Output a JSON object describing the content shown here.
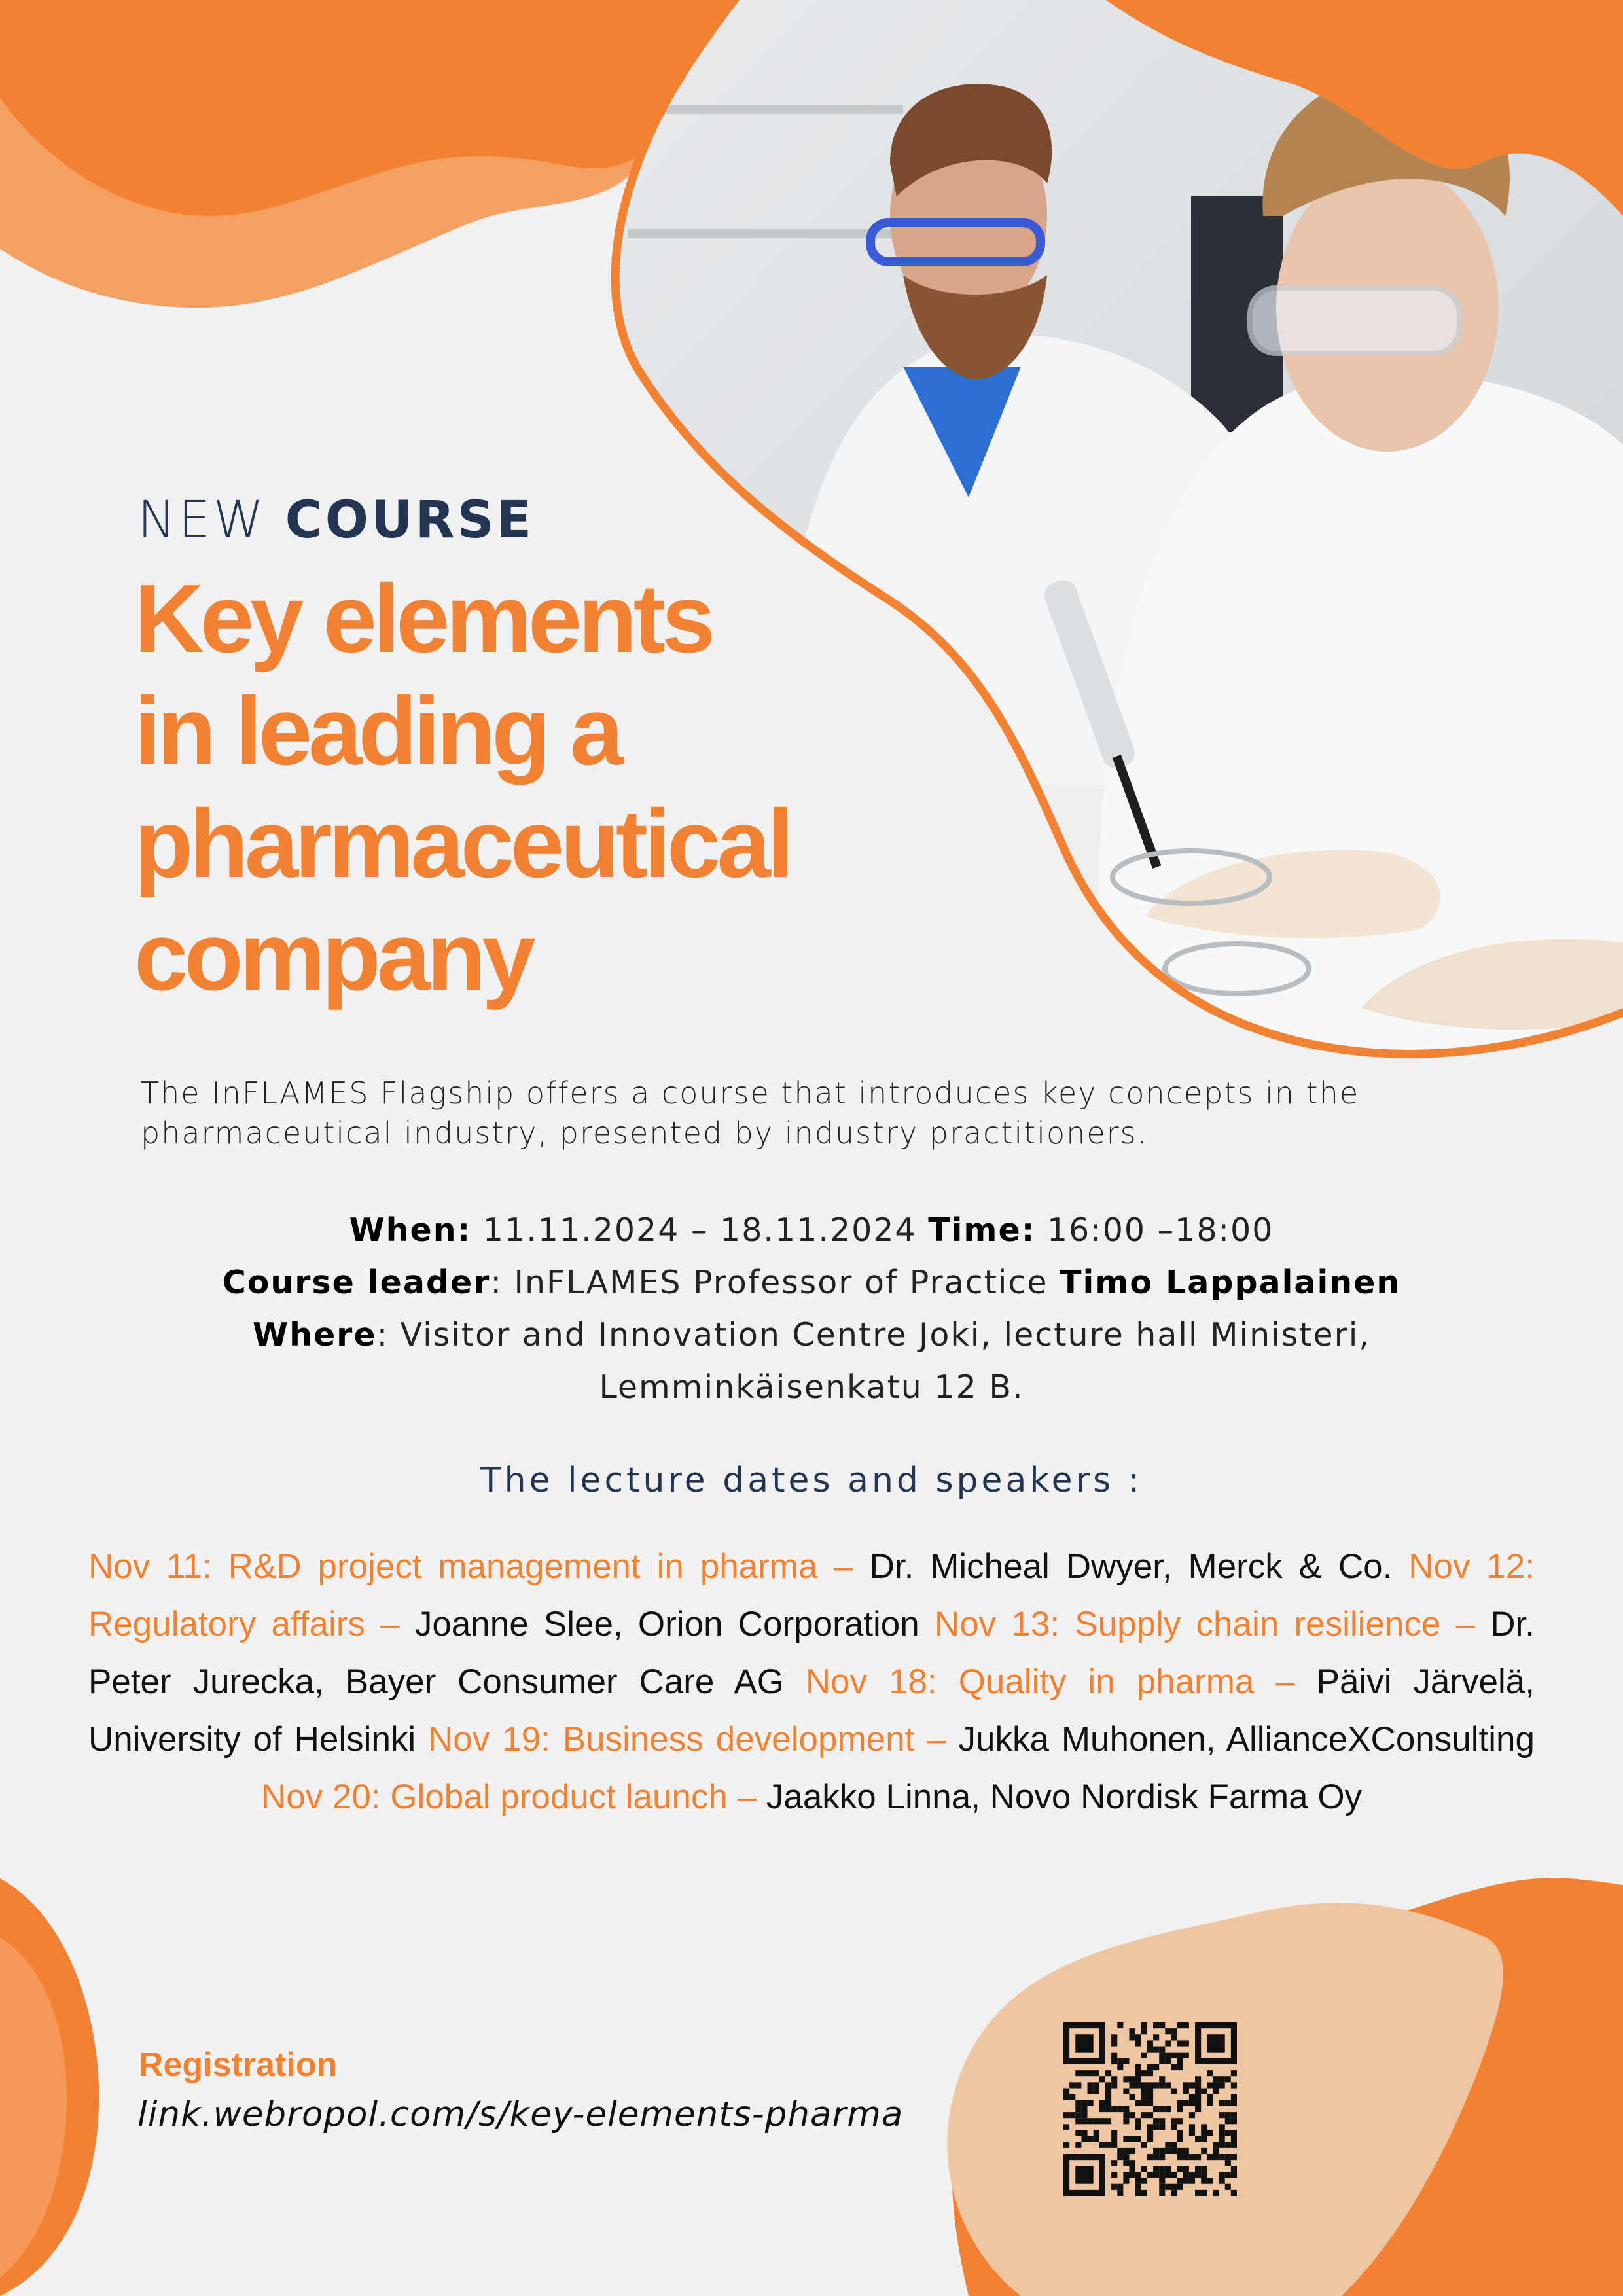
{
  "header": {
    "eyebrow_new": "NEW",
    "eyebrow_course": "COURSE",
    "title_lines": [
      "Key elements",
      "in leading a",
      "pharmaceutical",
      "company"
    ]
  },
  "intro": "The InFLAMES Flagship offers a course that introduces key concepts in the pharmaceutical industry, presented by industry practitioners.",
  "details": {
    "when_label": "When:",
    "when_value": "11.11.2024 – 18.11.2024",
    "time_label": "Time:",
    "time_value": "16:00 –18:00",
    "leader_label": "Course leader",
    "leader_prefix": ": InFLAMES Professor of Practice ",
    "leader_name": "Timo Lappalainen",
    "where_label": "Where",
    "where_value": ": Visitor and Innovation Centre Joki, lecture hall Ministeri,",
    "where_value_2": "Lemminkäisenkatu 12 B."
  },
  "lectures": {
    "heading": "The lecture dates and speakers :",
    "items": [
      {
        "topic": "Nov 11: R&D project management in pharma – ",
        "speaker": "Dr. Micheal Dwyer, Merck & Co."
      },
      {
        "topic": "Nov 12: Regulatory affairs – ",
        "speaker": "Joanne Slee, Orion Corporation"
      },
      {
        "topic": "Nov 13: Supply chain resilience – ",
        "speaker": "Dr. Peter Jurecka, Bayer Consumer Care AG"
      },
      {
        "topic": "Nov 18: Quality in pharma – ",
        "speaker": "Päivi Järvelä, University of Helsinki"
      },
      {
        "topic": "Nov 19: Business development – ",
        "speaker": "Jukka Muhonen, AllianceXConsulting"
      },
      {
        "topic": "Nov 20: Global product launch – ",
        "speaker": "Jaakko Linna, Novo Nordisk Farma Oy"
      }
    ]
  },
  "registration": {
    "label": "Registration",
    "link": "link.webropol.com/s/key-elements-pharma"
  },
  "colors": {
    "accent_orange": "#f28232",
    "navy": "#243553",
    "background": "#f1f1f1",
    "peach": "#eec6a3"
  },
  "icons": {
    "qr": "qr-code-icon"
  }
}
